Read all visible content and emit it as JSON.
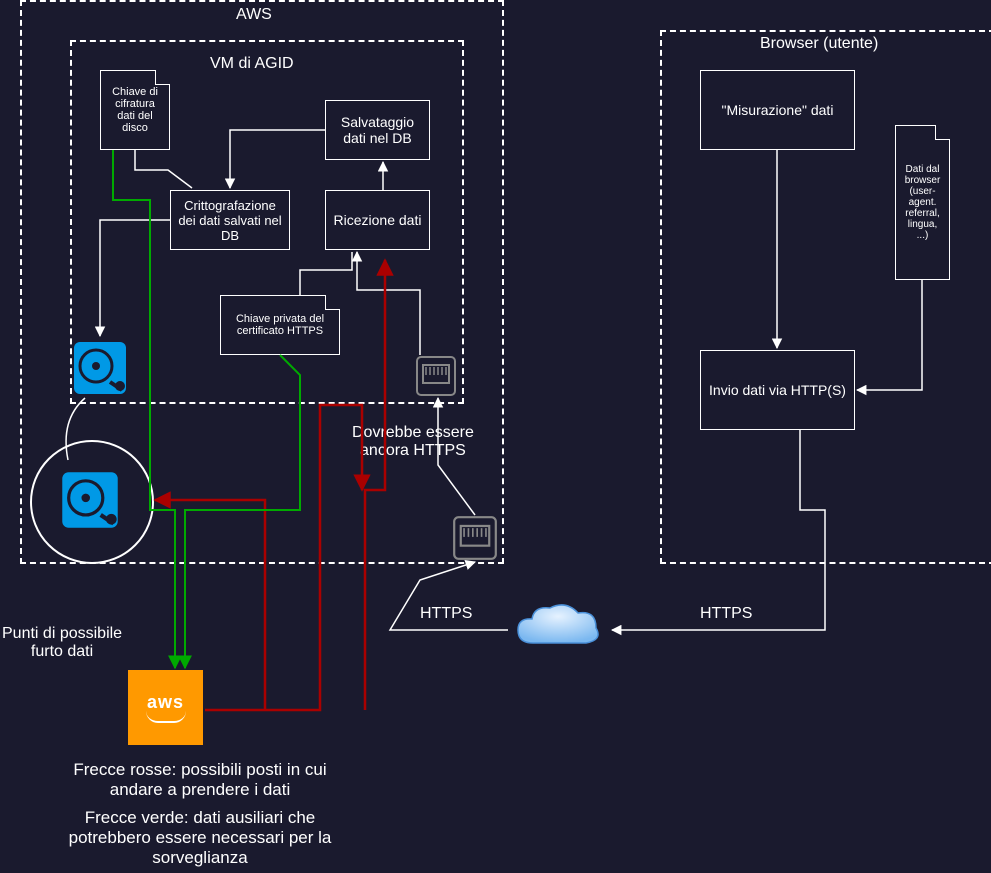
{
  "containers": {
    "aws": "AWS",
    "vm": "VM di AGID",
    "browser": "Browser (utente)"
  },
  "boxes": {
    "measure": "\"Misurazione\" dati",
    "send": "Invio dati via HTTP(S)",
    "receive": "Ricezione dati",
    "save": "Salvataggio dati nel DB",
    "encrypt": "Crittografazione dei dati salvati nel DB"
  },
  "notes": {
    "diskkey": "Chiave di cifratura dati del disco",
    "httpskey": "Chiave privata del certificato HTTPS",
    "browserdata": "Dati dal browser (user-agent. referral, lingua, ...)"
  },
  "labels": {
    "https1": "HTTPS",
    "https2": "HTTPS",
    "stillhttps": "Dovrebbe essere\nancora HTTPS",
    "theft": "Punti di possibile\nfurto dati"
  },
  "captions": {
    "red": "Frecce rosse: possibili posti in cui andare a prendere i dati",
    "green": "Frecce verde: dati ausiliari che potrebbero essere necessari per la sorveglianza"
  },
  "aws_logo": "aws"
}
